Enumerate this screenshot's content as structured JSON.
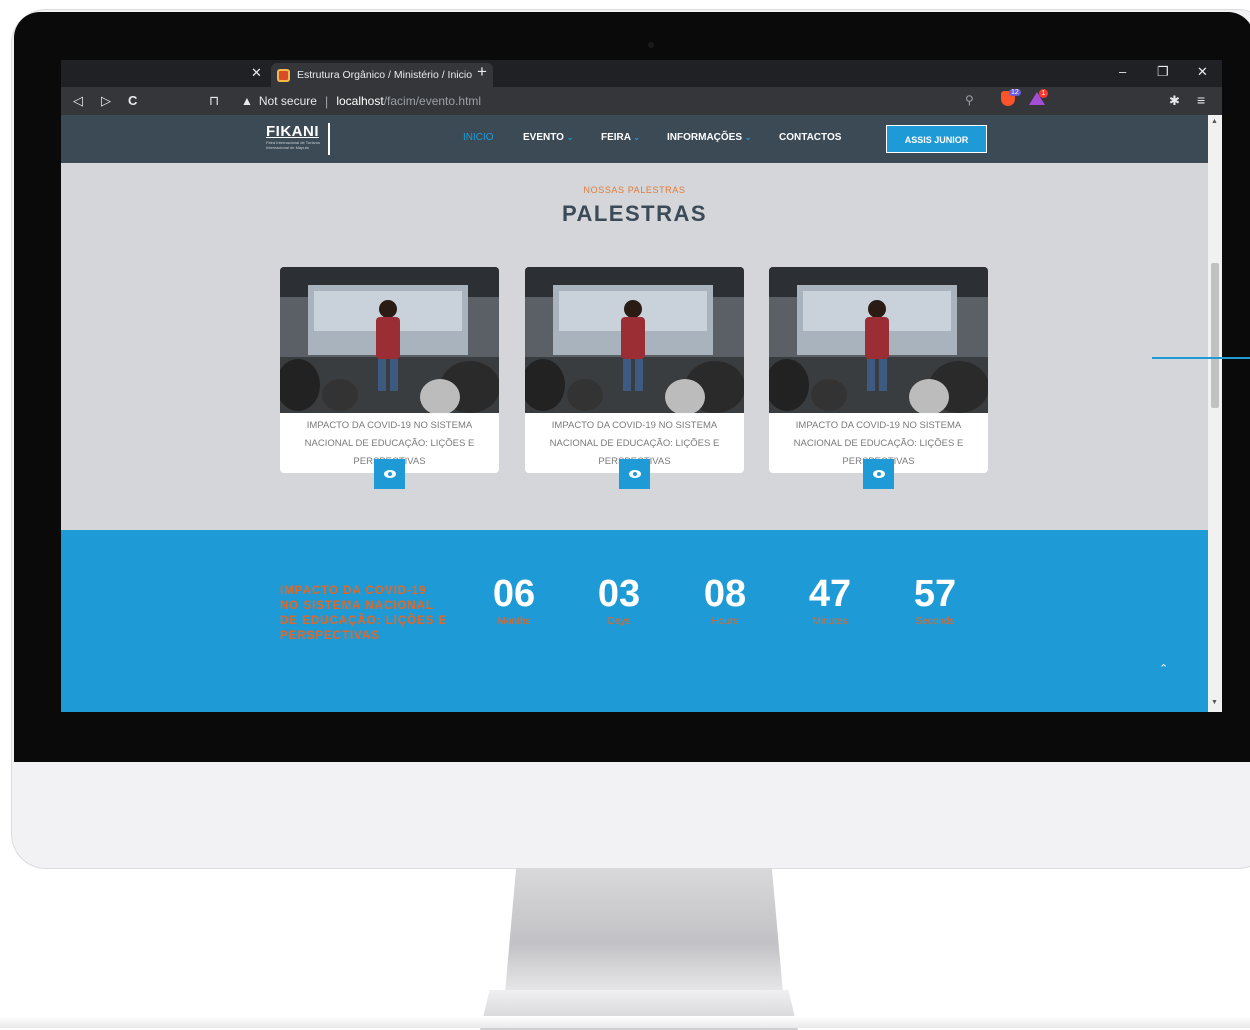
{
  "browser": {
    "tab_title": "Estrutura Orgânico / Ministério / Inicio",
    "close_prev_tab": "✕",
    "new_tab": "+",
    "window_controls": {
      "minimize": "–",
      "restore": "❐",
      "close": "✕"
    },
    "nav": {
      "back": "◁",
      "forward": "▷",
      "reload": "C",
      "bookmark": "⊓"
    },
    "security_icon": "▲",
    "security_label": "Not secure",
    "separator": "|",
    "url_host": "localhost",
    "url_path": "/facim/evento.html",
    "zoom_icon": "⚲",
    "brave_badge": "12",
    "rewards_badge": "1",
    "extensions_icon": "✱",
    "menu_icon": "≡"
  },
  "site": {
    "logo_text": "FIKANI",
    "logo_sub": "Feira Internacional de Turismo Internacional de Maputo",
    "nav": [
      {
        "label": "INICIO",
        "active": true,
        "dropdown": false
      },
      {
        "label": "EVENTO",
        "active": false,
        "dropdown": true
      },
      {
        "label": "FEIRA",
        "active": false,
        "dropdown": true
      },
      {
        "label": "INFORMAÇÕES",
        "active": false,
        "dropdown": true
      },
      {
        "label": "CONTACTOS",
        "active": false,
        "dropdown": false
      }
    ],
    "caret": "⌄",
    "user_button": "ASSIS JUNIOR"
  },
  "section": {
    "kicker": "NOSSAS PALESTRAS",
    "title": "PALESTRAS",
    "cards": [
      {
        "text": "IMPACTO DA COVID-19 NO SISTEMA NACIONAL DE EDUCAÇÃO: LIÇÕES E PERSPECTIVAS"
      },
      {
        "text": "IMPACTO DA COVID-19 NO SISTEMA NACIONAL DE EDUCAÇÃO: LIÇÕES E PERSPECTIVAS"
      },
      {
        "text": "IMPACTO DA COVID-19 NO SISTEMA NACIONAL DE EDUCAÇÃO: LIÇÕES E PERSPECTIVAS"
      }
    ]
  },
  "countdown": {
    "title": "IMPACTO DA COVID-19 NO SISTEMA NACIONAL DE EDUCAÇÃO: LIÇÕES E PERSPECTIVAS",
    "units": [
      {
        "value": "06",
        "label": "Months"
      },
      {
        "value": "03",
        "label": "Days"
      },
      {
        "value": "08",
        "label": "Hours"
      },
      {
        "value": "47",
        "label": "Minutes"
      },
      {
        "value": "57",
        "label": "Seconds"
      }
    ],
    "back_to_top": "⌃"
  },
  "colors": {
    "accent": "#1e9bd7",
    "orange": "#e8651f",
    "nav_bg": "#3c4a55",
    "page_bg": "#d4d6d9"
  }
}
